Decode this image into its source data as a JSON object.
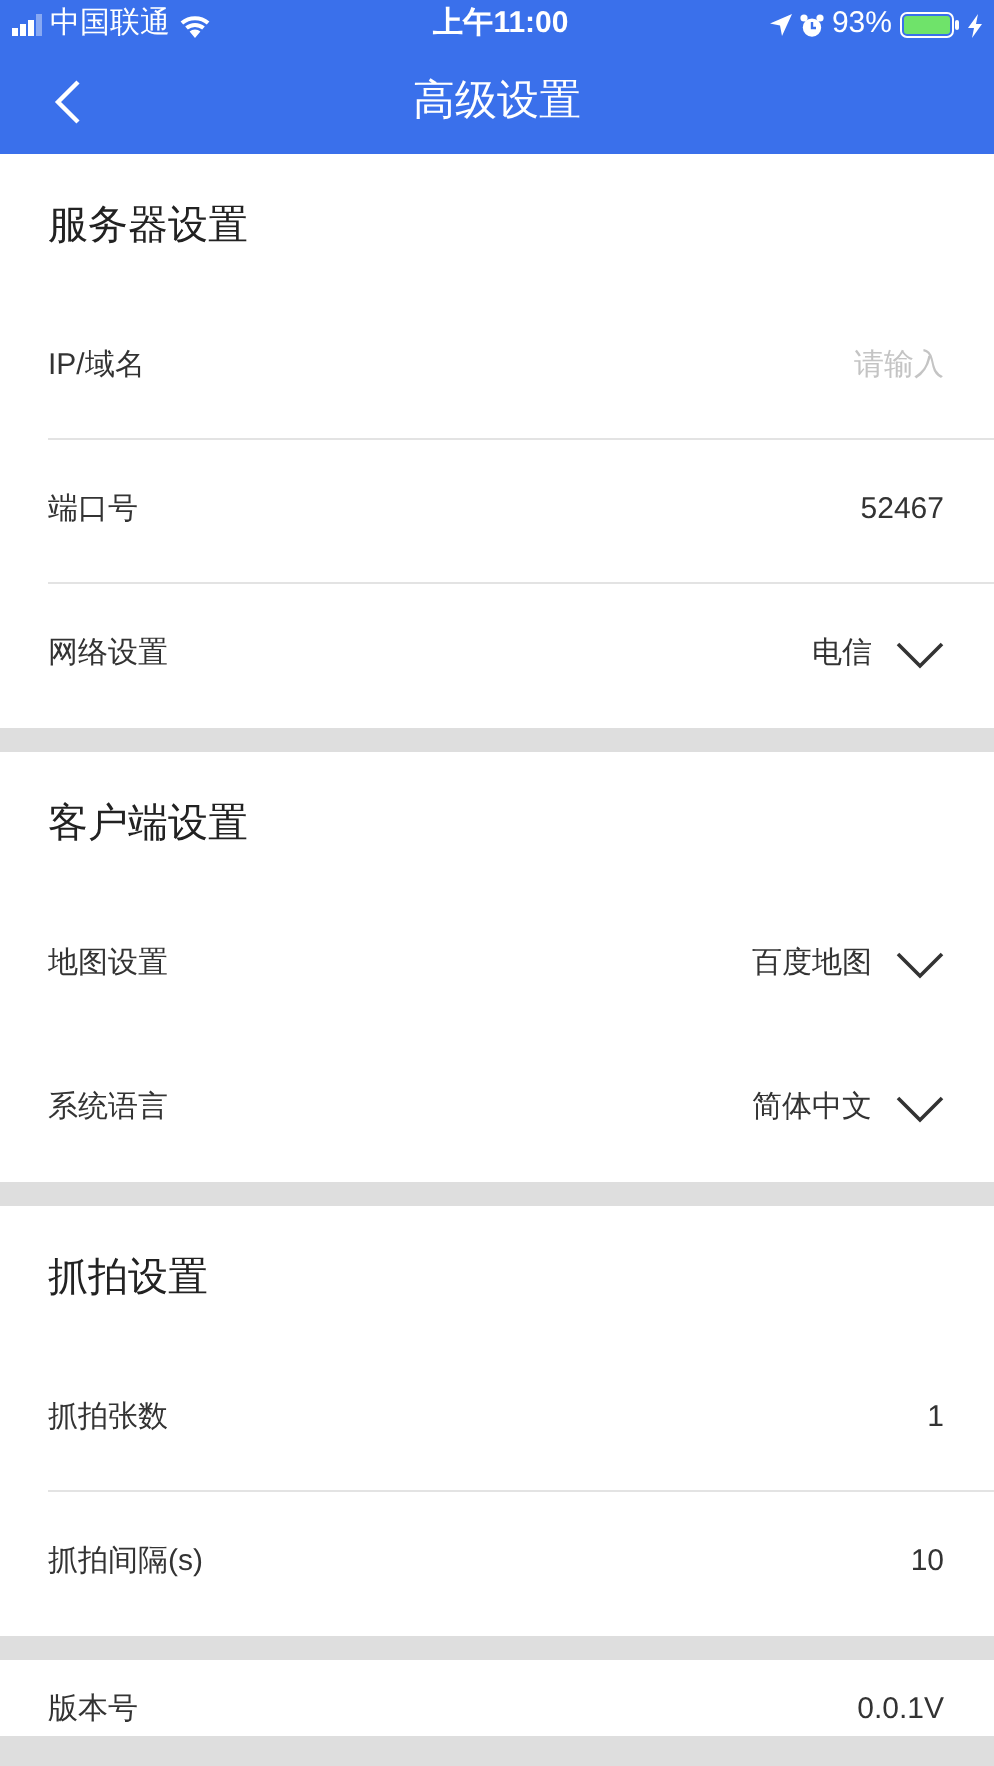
{
  "status_bar": {
    "carrier": "中国联通",
    "time": "上午11:00",
    "battery": "93%"
  },
  "nav": {
    "title": "高级设置"
  },
  "sections": [
    {
      "title": "服务器设置",
      "rows": [
        {
          "kind": "input",
          "label": "IP/域名",
          "placeholder": "请输入",
          "separated": true
        },
        {
          "kind": "text",
          "label": "端口号",
          "value": "52467",
          "separated": true
        },
        {
          "kind": "select",
          "label": "网络设置",
          "value": "电信",
          "separated": false
        }
      ]
    },
    {
      "title": "客户端设置",
      "rows": [
        {
          "kind": "select",
          "label": "地图设置",
          "value": "百度地图",
          "separated": false
        },
        {
          "kind": "select",
          "label": "系统语言",
          "value": "简体中文",
          "separated": false
        }
      ]
    },
    {
      "title": "抓拍设置",
      "rows": [
        {
          "kind": "text",
          "label": "抓拍张数",
          "value": "1",
          "separated": true
        },
        {
          "kind": "text",
          "label": "抓拍间隔(s)",
          "value": "10",
          "separated": false
        }
      ]
    }
  ],
  "footer_row": {
    "label": "版本号",
    "value": "0.0.1V"
  }
}
